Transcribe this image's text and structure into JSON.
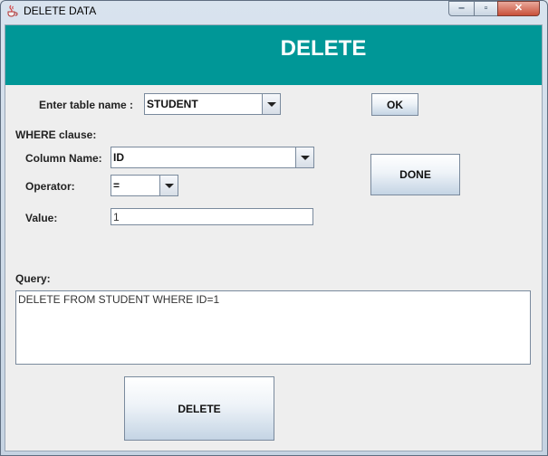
{
  "window": {
    "title": "DELETE DATA",
    "controls": {
      "minimize": "‒",
      "maximize": "▫",
      "close": "✕"
    }
  },
  "header": {
    "title": "DELETE"
  },
  "form": {
    "table_label": "Enter table name :",
    "table_value": "STUDENT",
    "ok_label": "OK",
    "where_label": "WHERE clause:",
    "column_label": "Column Name:",
    "column_value": "ID",
    "operator_label": "Operator:",
    "operator_value": "=",
    "value_label": "Value:",
    "value_value": "1",
    "done_label": "DONE",
    "query_label": "Query:",
    "query_value": "DELETE FROM STUDENT WHERE ID=1",
    "delete_label": "DELETE"
  },
  "colors": {
    "header": "#009797",
    "header_text": "#ffffff"
  }
}
